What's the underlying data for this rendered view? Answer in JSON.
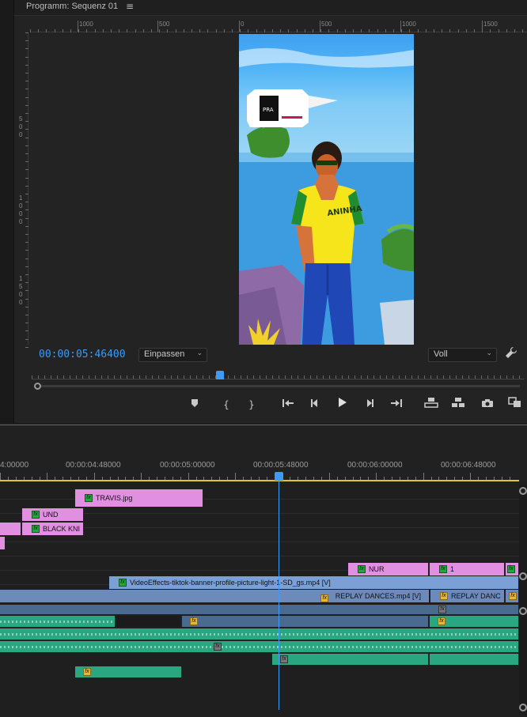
{
  "monitor": {
    "title": "Programm: Sequenz 01",
    "menu_icon": "≡",
    "timecode": "00:00:05:46400",
    "fit_label": "Einpassen",
    "quality_label": "Voll",
    "ruler_h_labels": [
      "1000",
      "500",
      "0",
      "500",
      "1000",
      "1500"
    ],
    "ruler_v_labels": [
      "500",
      "0",
      "1000",
      "1500"
    ],
    "video": {
      "sign_text": "PRA",
      "shirt_text": "ANINHA"
    }
  },
  "transport_icons": [
    "marker-icon",
    "in-point-icon",
    "out-point-icon",
    "go-to-in-icon",
    "step-back-icon",
    "play-icon",
    "step-forward-icon",
    "go-to-out-icon",
    "lift-icon",
    "extract-icon",
    "export-frame-icon",
    "compare-icon"
  ],
  "timeline": {
    "time_labels": [
      "4:00000",
      "00:00:04:48000",
      "00:00:05:00000",
      "00:00:05:48000",
      "00:00:06:00000",
      "00:00:06:48000"
    ],
    "clips": {
      "travis": "TRAVIS.jpg",
      "und": "UND",
      "black": "BLACK KNI",
      "nur": "NUR",
      "one": "1",
      "video_effects": "VideoEffects-tiktok-banner-profile-picture-light-1-SD_gs.mp4 [V]",
      "replay": "REPLAY DANCES.mp4 [V]",
      "replay_short": "REPLAY DANC"
    },
    "fx_label": "fx"
  }
}
